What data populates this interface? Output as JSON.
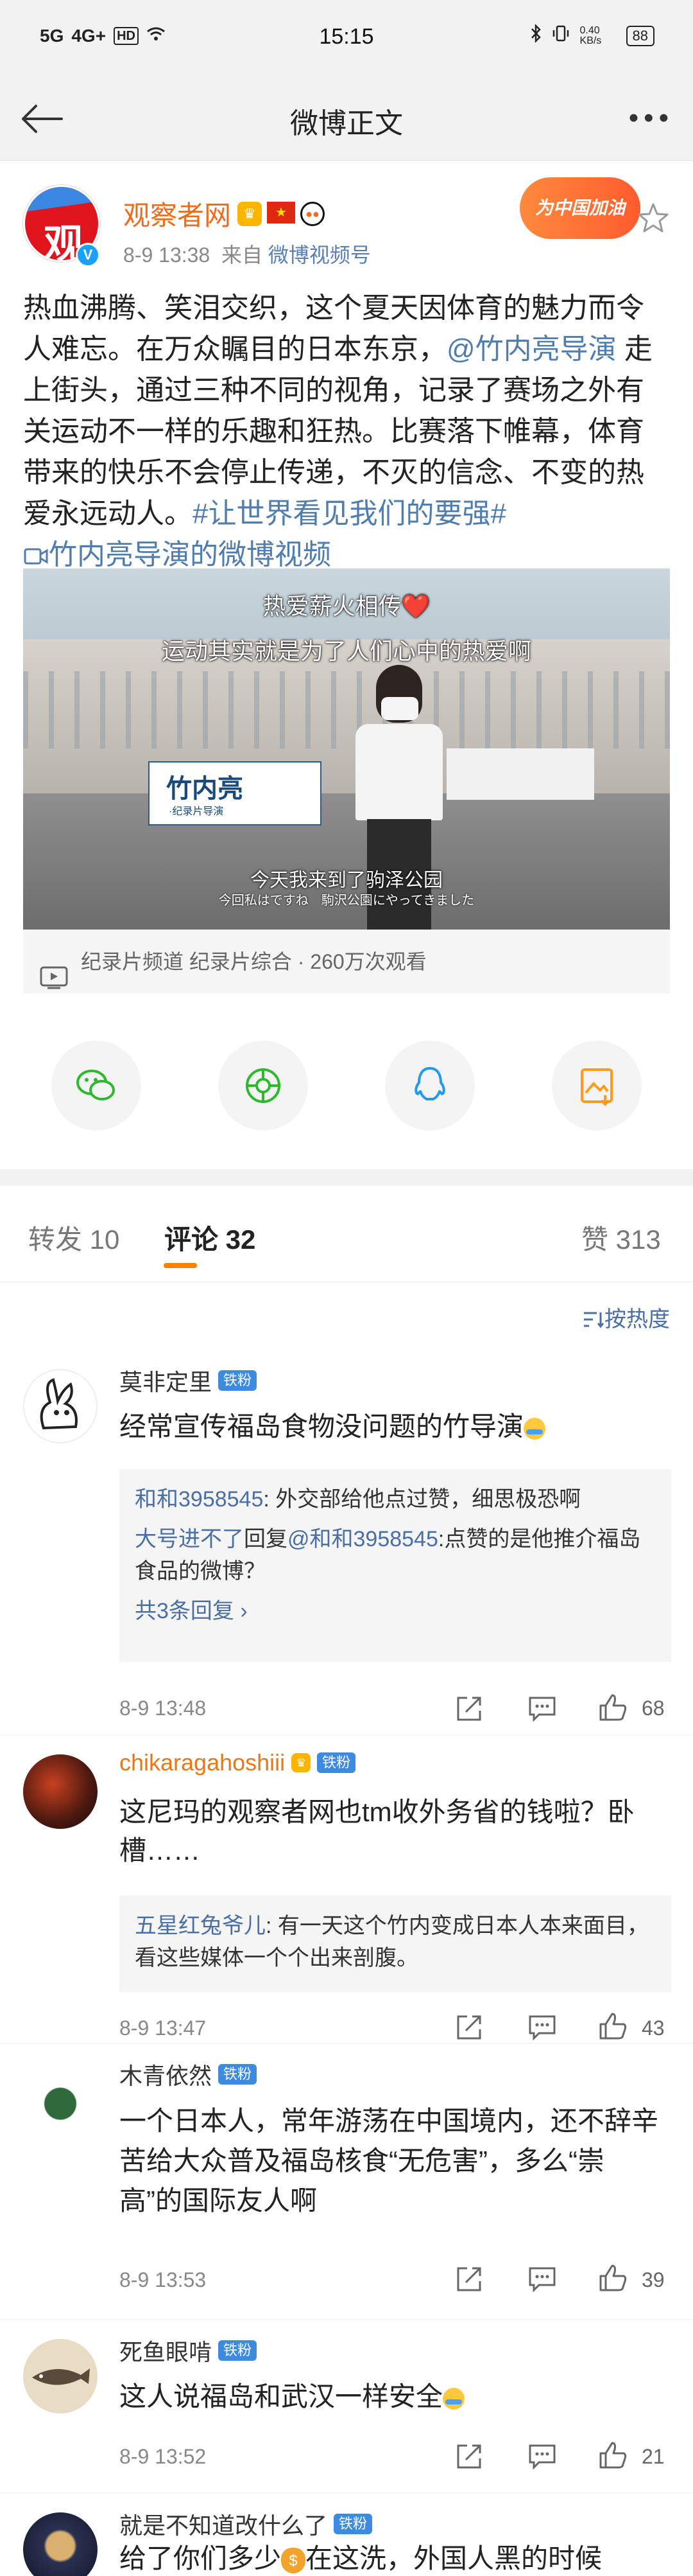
{
  "status_bar": {
    "signal_left": "5G",
    "signal_mid": "4G+",
    "hd_label": "HD",
    "time": "15:15",
    "net_speed": "0.40 KB/s",
    "battery": "88"
  },
  "nav": {
    "title": "微博正文"
  },
  "post": {
    "author": "观察者网",
    "time": "8-9 13:38",
    "source_prefix": "来自",
    "source": "微博视频号",
    "promo_badge": "为中国加油",
    "text_part1": "热血沸腾、笑泪交织，这个夏天因体育的魅力而令人难忘。在万众瞩目的日本东京，",
    "mention": "@竹内亮导演",
    "text_part2": " 走上街头，通过三种不同的视角，记录了赛场之外有关运动不一样的乐趣和狂热。比赛落下帷幕，体育带来的快乐不会停止传递，不灭的信念、不变的热爱永远动人。",
    "hashtag": "#让世界看见我们的要强#",
    "video_link": "竹内亮导演的微博视频",
    "video": {
      "caption_top1": "热爱薪火相传❤️",
      "caption_top2": "运动其实就是为了人们心中的热爱啊",
      "nameplate": "竹内亮",
      "nameplate_sub": "·纪录片导演",
      "caption_bottom": "今天我来到了驹泽公园",
      "caption_bottom_jp": "今回私はですね　駒沢公園にやってきました"
    },
    "video_info": "纪录片频道 纪录片综合 · 260万次观看"
  },
  "tabs": {
    "repost": "转发 10",
    "comments": "评论 32",
    "likes": "赞 313"
  },
  "sort": {
    "label": "按热度"
  },
  "comments": [
    {
      "name": "莫非定里",
      "badge": "铁粉",
      "text": "经常宣传福岛食物没问题的竹导演",
      "replies": [
        {
          "name": "和和3958545",
          "text": ": 外交部给他点过赞，细思极恐啊"
        },
        {
          "name": "大号进不了",
          "text_prefix": "回复",
          "mention": "@和和3958545",
          "text": ":点赞的是他推介福岛食品的微博？"
        }
      ],
      "more": "共3条回复 ›",
      "time": "8-9 13:48",
      "likes": "68"
    },
    {
      "name": "chikaragahoshiii",
      "badge": "铁粉",
      "text": "这尼玛的观察者网也tm收外务省的钱啦？卧槽……",
      "replies": [
        {
          "name": "五星红兔爷儿",
          "text": ": 有一天这个竹内变成日本人本来面目，看这些媒体一个个出来剖腹。"
        }
      ],
      "time": "8-9 13:47",
      "likes": "43"
    },
    {
      "name": "木青依然",
      "badge": "铁粉",
      "text": "一个日本人，常年游荡在中国境内，还不辞辛苦给大众普及福岛核食“无危害”，多么“崇高”的国际友人啊",
      "time": "8-9 13:53",
      "likes": "39"
    },
    {
      "name": "死鱼眼啃",
      "badge": "铁粉",
      "text": "这人说福岛和武汉一样安全",
      "time": "8-9 13:52",
      "likes": "21"
    },
    {
      "name": "就是不知道改什么了",
      "badge": "铁粉",
      "text_part1": "给了你们多少",
      "text_part2": "在这洗，外国人黑的时候"
    }
  ],
  "colors": {
    "accent_orange": "#ff8200",
    "link_blue": "#507daf",
    "author_orange": "#f06b1c"
  }
}
